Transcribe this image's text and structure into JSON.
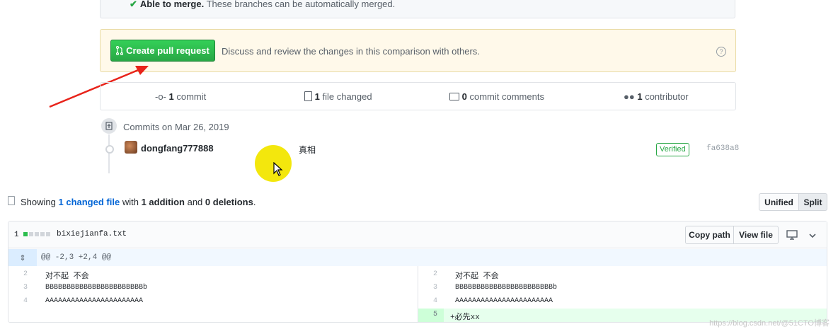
{
  "merge": {
    "check": "✔",
    "title": "Able to merge.",
    "desc": "These branches can be automatically merged."
  },
  "pr": {
    "button": "Create pull request",
    "description": "Discuss and review the changes in this comparison with others.",
    "help": "?"
  },
  "stats": {
    "commits_count": "1",
    "commits_label": "commit",
    "files_count": "1",
    "files_label": "file changed",
    "comments_count": "0",
    "comments_label": "commit comments",
    "contributors_count": "1",
    "contributors_label": "contributor"
  },
  "commits": {
    "date_label": "Commits on Mar 26, 2019",
    "items": [
      {
        "author": "dongfang777888",
        "message": "真相",
        "badge": "Verified",
        "sha": "fa638a8"
      }
    ]
  },
  "diff_summary": {
    "prefix": "Showing",
    "link": "1 changed file",
    "with": "with",
    "additions": "1 addition",
    "and": "and",
    "deletions": "0 deletions",
    "end": "."
  },
  "view_toggle": {
    "unified": "Unified",
    "split": "Split"
  },
  "file": {
    "count": "1",
    "name": "bixiejianfa.txt",
    "copy_path": "Copy path",
    "view_file": "View file",
    "hunk": "@@ -2,3 +2,4 @@",
    "left_lines": [
      {
        "n": "2",
        "text": "对不起 不会"
      },
      {
        "n": "3",
        "text": "BBBBBBBBBBBBBBBBBBBBBBBb"
      },
      {
        "n": "4",
        "text": "AAAAAAAAAAAAAAAAAAAAAAA"
      }
    ],
    "right_lines": [
      {
        "n": "2",
        "text": "对不起 不会"
      },
      {
        "n": "3",
        "text": "BBBBBBBBBBBBBBBBBBBBBBBb"
      },
      {
        "n": "4",
        "text": "AAAAAAAAAAAAAAAAAAAAAAA"
      },
      {
        "n": "5",
        "text": "+必先xx"
      }
    ]
  },
  "colors": {
    "green": "#2ea44f",
    "link": "#0366d6",
    "add_bg": "#e6ffed",
    "arrow": "#e8231a"
  },
  "watermark": "https://blog.csdn.net/@51CTO博客"
}
